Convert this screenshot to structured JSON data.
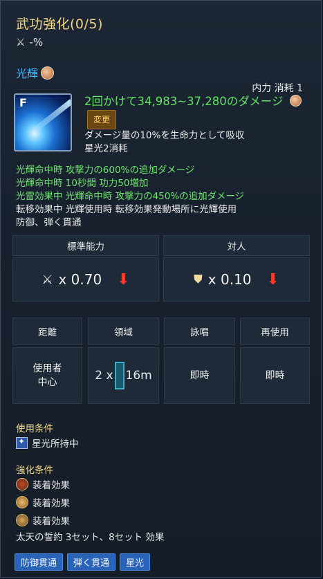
{
  "tooltip": {
    "title": "武功強化(0/5)",
    "sub_value": "-%",
    "skill_name": "光輝",
    "cost_label": "内力  消耗  1",
    "skill_key": "F",
    "damage_line": "2回かけて34,983~37,280のダメージ",
    "change_badge": "変更",
    "desc": [
      "ダメージ量の10%を生命力として吸収",
      "星光2消耗"
    ],
    "effects": [
      {
        "text": "光輝命中時  攻撃力の600%の追加ダメージ",
        "color": "green"
      },
      {
        "text": "光輝命中時  10秒間  功力50増加",
        "color": "green"
      },
      {
        "text": "光雷効果中  光輝命中時  攻撃力の450%の追加ダメージ",
        "color": "green"
      },
      {
        "text": "転移効果中  光輝使用時  転移効果発動場所に光輝使用",
        "color": "white"
      },
      {
        "text": "防御、弾く貫通",
        "color": "white"
      }
    ],
    "stats": {
      "headers": [
        "標準能力",
        "対人"
      ],
      "pve_value": "x 0.70",
      "pvp_value": "x 0.10"
    },
    "info": {
      "headers": [
        "距離",
        "領域",
        "詠唱",
        "再使用"
      ],
      "distance": "使用者\n中心",
      "area_left": "2 x",
      "area_right": "16m",
      "cast": "即時",
      "cooldown": "即時"
    },
    "use_conditions": {
      "label": "使用条件",
      "items": [
        "星光所持中"
      ]
    },
    "enhance_conditions": {
      "label": "強化条件",
      "items": [
        "装着効果",
        "装着効果",
        "装着効果"
      ],
      "set_text": "太天の誓約  3セット、8セット  効果"
    },
    "tags": [
      "防御貫通",
      "弾く貫通",
      "星光"
    ]
  },
  "colors": {
    "title": "#f2d98a",
    "skill_name": "#49b8ff",
    "damage": "#5fe35f",
    "down_arrow": "#ff3a2a",
    "tag": "#2a64b8"
  },
  "icons": {
    "sub": "crossed-swords-icon",
    "skill": "fist-icon",
    "pve": "crossed-swords-icon",
    "pvp": "pvp-icon",
    "down": "red-down-arrow-icon",
    "use": "star-light-icon",
    "enhance": "equipment-icon"
  }
}
